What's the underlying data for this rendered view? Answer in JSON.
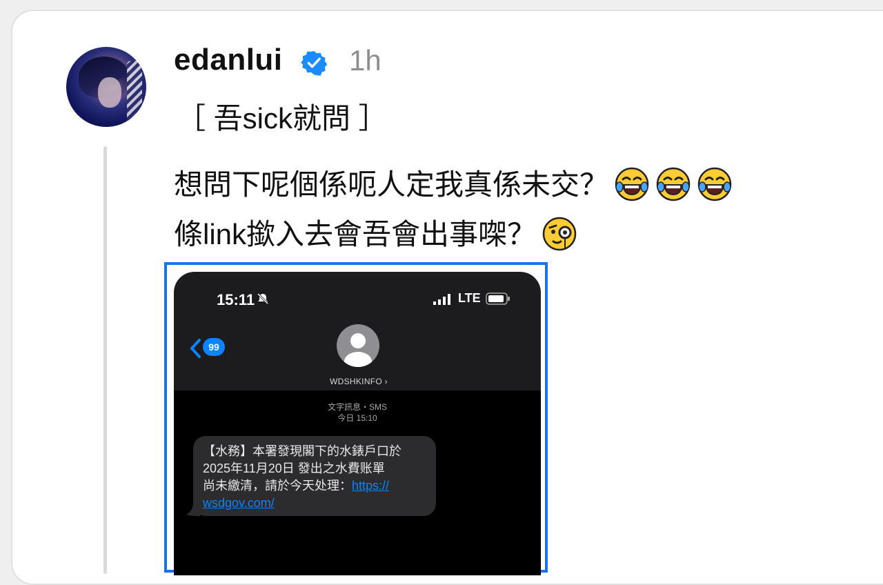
{
  "post": {
    "username": "edanlui",
    "time": "1h",
    "tag": "［ 吾sick就問 ］",
    "body_line1": "想問下呢個係呃人定我真係未交？",
    "body_line2": "條link撳入去會吾會出事㗎？",
    "emojis_line1": [
      "face-with-tears-of-joy-icon",
      "face-with-tears-of-joy-icon",
      "face-with-tears-of-joy-icon"
    ],
    "emoji_line2": "face-with-monocle-icon"
  },
  "screenshot": {
    "status_time": "15:11",
    "network": "LTE",
    "back_count": "99",
    "contact": "WDSHKINFO",
    "meta_line1": "文字訊息・SMS",
    "meta_line2": "今日 15:10",
    "sms_line1": "【水務】本署發現閣下的水錶戶口於",
    "sms_line2": "2025年11月20日 發出之水費账單",
    "sms_line3_text": "尚未繳清，請於今天处理：",
    "sms_link_part1": "https://",
    "sms_link_part2": "wsdgov.com/"
  },
  "colors": {
    "verified": "#1a8cff",
    "link": "#0a84ff",
    "frame_border": "#1a73e8"
  }
}
